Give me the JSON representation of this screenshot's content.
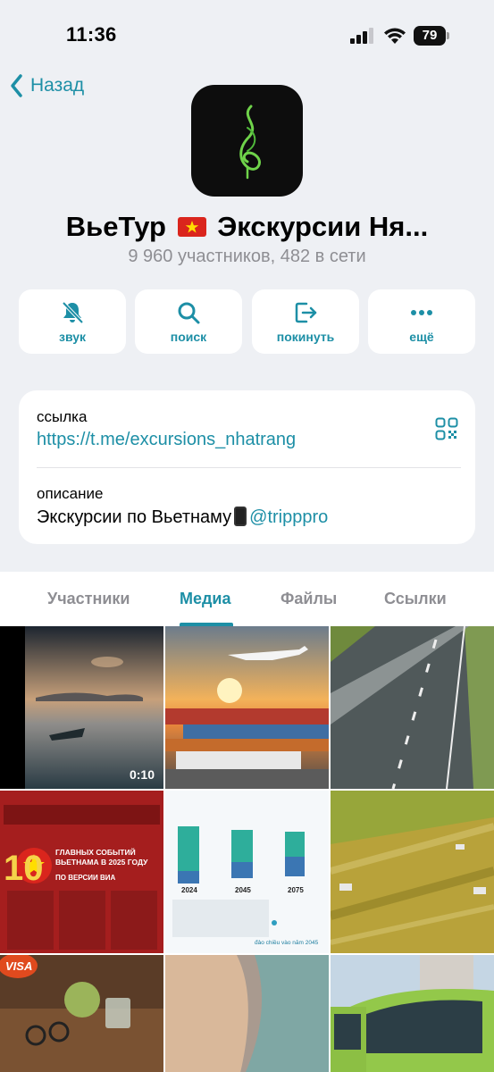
{
  "status_bar": {
    "time": "11:36",
    "battery": "79"
  },
  "nav": {
    "back_label": "Назад"
  },
  "channel": {
    "title_part1": "ВьеТур",
    "title_part2": "Экскурсии Ня...",
    "members": "9 960 участников, 482 в сети"
  },
  "actions": [
    {
      "label": "звук",
      "icon": "bell-slash-icon"
    },
    {
      "label": "поиск",
      "icon": "search-icon"
    },
    {
      "label": "покинуть",
      "icon": "leave-icon"
    },
    {
      "label": "ещё",
      "icon": "more-icon"
    }
  ],
  "info": {
    "link_label": "ссылка",
    "link": "https://t.me/excursions_nhatrang",
    "description_label": "описание",
    "description_text": "Экскурсии по Вьетнаму",
    "description_handle": "@tripppro"
  },
  "tabs": [
    "Участники",
    "Медиа",
    "Файлы",
    "Ссылки"
  ],
  "media": {
    "video_duration": "0:10",
    "tile_overlay_text": {
      "events_number": "10",
      "events_title": "ГЛАВНЫХ СОБЫТИЙ ВЬЕТНАМА В 2025 ГОДУ",
      "events_subtitle": "ПО ВЕРСИИ ВИА",
      "chart_years": [
        "2024",
        "2045",
        "2075"
      ],
      "chart_caption": "đảo chiều vào năm 2045",
      "visa_badge": "VISA"
    }
  },
  "colors": {
    "accent": "#1d8fa6",
    "background": "#eef0f4"
  }
}
